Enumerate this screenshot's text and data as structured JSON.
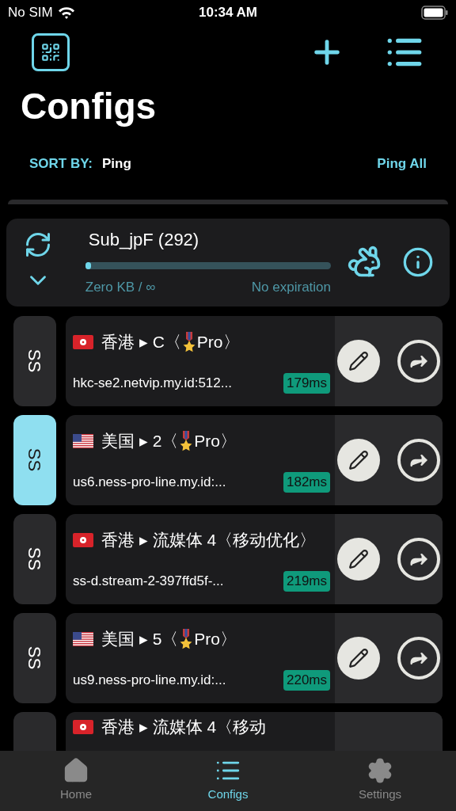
{
  "status_bar": {
    "carrier": "No SIM",
    "time": "10:34 AM"
  },
  "title": "Configs",
  "sort": {
    "label": "SORT BY:",
    "value": "Ping",
    "action": "Ping All"
  },
  "subscription": {
    "name": "Sub_jpF (292)",
    "level": 0.01,
    "usage": "Zero KB / ∞",
    "expiry": "No expiration"
  },
  "configs": [
    {
      "type": "SS",
      "selected": false,
      "kind": "hk",
      "title": "香港 ▸ C〈",
      "medal": true,
      "title_end": "Pro〉",
      "address": "hkc-se2.netvip.my.id:512...",
      "ping": "179ms"
    },
    {
      "type": "SS",
      "selected": true,
      "kind": "us",
      "title": "美国 ▸ 2〈",
      "medal": true,
      "title_end": "Pro〉",
      "address": "us6.ness-pro-line.my.id:...",
      "ping": "182ms"
    },
    {
      "type": "SS",
      "selected": false,
      "kind": "hk",
      "title": "香港 ▸ 流媒体 4〈移动优化〉",
      "medal": false,
      "address": "ss-d.stream-2-397ffd5f-...",
      "ping": "219ms"
    },
    {
      "type": "SS",
      "selected": false,
      "kind": "us",
      "title": "美国 ▸ 5〈",
      "medal": true,
      "title_end": "Pro〉",
      "address": "us9.ness-pro-line.my.id:...",
      "ping": "220ms"
    },
    {
      "selected": false,
      "kind": "hk",
      "title": "香港 ▸ 流媒体 4〈移动",
      "medal": false
    }
  ],
  "tabs": [
    {
      "label": "Home",
      "selected": false
    },
    {
      "label": "Configs",
      "selected": true
    },
    {
      "label": "Settings",
      "selected": false
    }
  ]
}
